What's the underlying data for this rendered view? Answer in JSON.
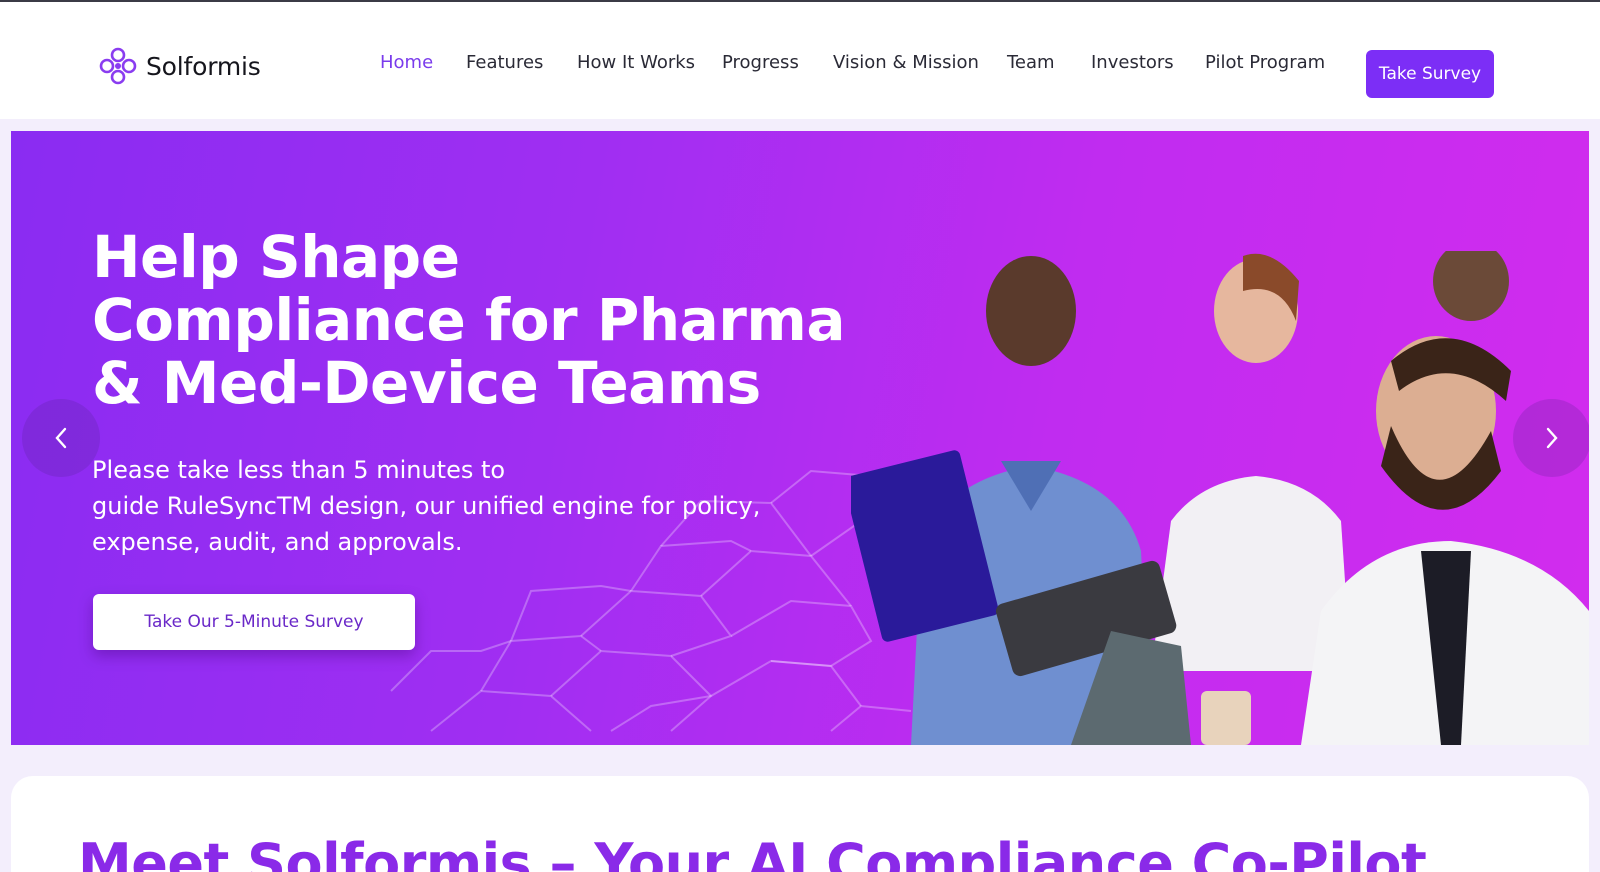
{
  "header": {
    "brand": "Solformis",
    "nav": [
      {
        "label": "Home",
        "active": true
      },
      {
        "label": "Features",
        "active": false
      },
      {
        "label": "How It Works",
        "active": false
      },
      {
        "label": "Progress",
        "active": false
      },
      {
        "label": "Vision & Mission",
        "active": false
      },
      {
        "label": "Team",
        "active": false
      },
      {
        "label": "Investors",
        "active": false
      },
      {
        "label": "Pilot Program",
        "active": false
      }
    ],
    "cta_label": "Take Survey"
  },
  "hero": {
    "title_lines": [
      "Help Shape",
      "Compliance for Pharma",
      "& Med-Device Teams"
    ],
    "subtitle_lines": [
      "Please take less than 5 minutes to",
      "guide RuleSyncTM design, our unified engine for policy,",
      "expense, audit, and approvals."
    ],
    "button_label": "Take Our 5-Minute Survey",
    "prev_icon": "chevron-left-icon",
    "next_icon": "chevron-right-icon"
  },
  "section": {
    "heading": "Meet Solformis – Your AI Compliance Co-Pilot"
  },
  "colors": {
    "accent": "#7c2ef6",
    "nav_active": "#7a3bec",
    "hero_gradient_start": "#8a2cf2",
    "hero_gradient_end": "#d22cee",
    "heading": "#8a2ae8",
    "page_bg": "#f3eefc"
  }
}
